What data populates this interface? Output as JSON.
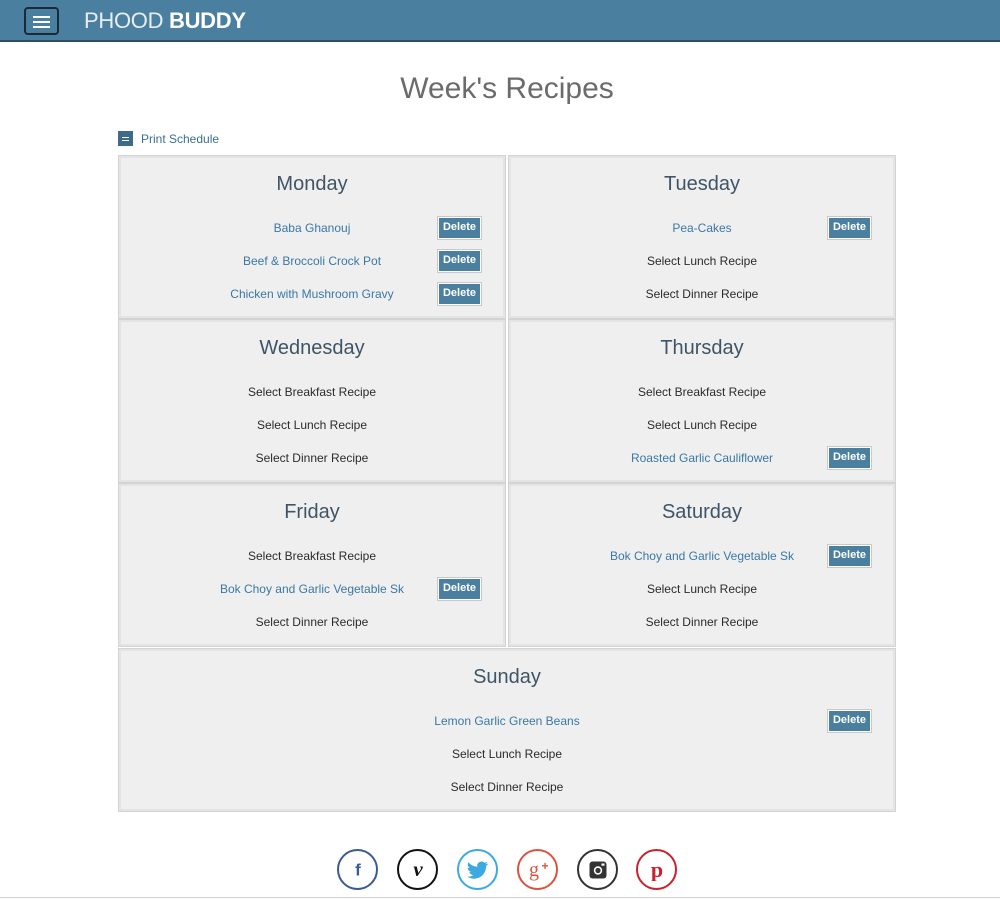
{
  "navbar": {
    "brand_light": "PHOOD ",
    "brand_bold": "BUDDY"
  },
  "page": {
    "title": "Week's Recipes",
    "print_label": "Print Schedule"
  },
  "delete_label": "Delete",
  "days": [
    {
      "name": "Monday",
      "meals": [
        {
          "text": "Baba Ghanouj",
          "selected": true
        },
        {
          "text": "Beef & Broccoli Crock Pot",
          "selected": true
        },
        {
          "text": "Chicken with Mushroom Gravy",
          "selected": true
        }
      ]
    },
    {
      "name": "Tuesday",
      "meals": [
        {
          "text": "Pea-Cakes",
          "selected": true
        },
        {
          "text": "Select Lunch Recipe",
          "selected": false
        },
        {
          "text": "Select Dinner Recipe",
          "selected": false
        }
      ]
    },
    {
      "name": "Wednesday",
      "meals": [
        {
          "text": "Select Breakfast Recipe",
          "selected": false
        },
        {
          "text": "Select Lunch Recipe",
          "selected": false
        },
        {
          "text": "Select Dinner Recipe",
          "selected": false
        }
      ]
    },
    {
      "name": "Thursday",
      "meals": [
        {
          "text": "Select Breakfast Recipe",
          "selected": false
        },
        {
          "text": "Select Lunch Recipe",
          "selected": false
        },
        {
          "text": "Roasted Garlic Cauliflower",
          "selected": true
        }
      ]
    },
    {
      "name": "Friday",
      "meals": [
        {
          "text": "Select Breakfast Recipe",
          "selected": false
        },
        {
          "text": "Bok Choy and Garlic Vegetable Sk",
          "selected": true
        },
        {
          "text": "Select Dinner Recipe",
          "selected": false
        }
      ]
    },
    {
      "name": "Saturday",
      "meals": [
        {
          "text": "Bok Choy and Garlic Vegetable Sk",
          "selected": true
        },
        {
          "text": "Select Lunch Recipe",
          "selected": false
        },
        {
          "text": "Select Dinner Recipe",
          "selected": false
        }
      ]
    },
    {
      "name": "Sunday",
      "meals": [
        {
          "text": "Lemon Garlic Green Beans",
          "selected": true
        },
        {
          "text": "Select Lunch Recipe",
          "selected": false
        },
        {
          "text": "Select Dinner Recipe",
          "selected": false
        }
      ]
    }
  ],
  "social": [
    {
      "icon": "facebook-icon",
      "glyph": "f",
      "color": "#3b5b93"
    },
    {
      "icon": "vimeo-icon",
      "glyph": "v",
      "color": "#111111"
    },
    {
      "icon": "twitter-icon",
      "glyph": "bird",
      "color": "#3ea9e0"
    },
    {
      "icon": "google-plus-icon",
      "glyph": "g+",
      "color": "#d9543f"
    },
    {
      "icon": "instagram-icon",
      "glyph": "cam",
      "color": "#333333"
    },
    {
      "icon": "pinterest-icon",
      "glyph": "p",
      "color": "#c8232c"
    }
  ],
  "colors": {
    "accent": "#4a7f9f",
    "link": "#3a78a6",
    "card_bg": "#efefef"
  }
}
